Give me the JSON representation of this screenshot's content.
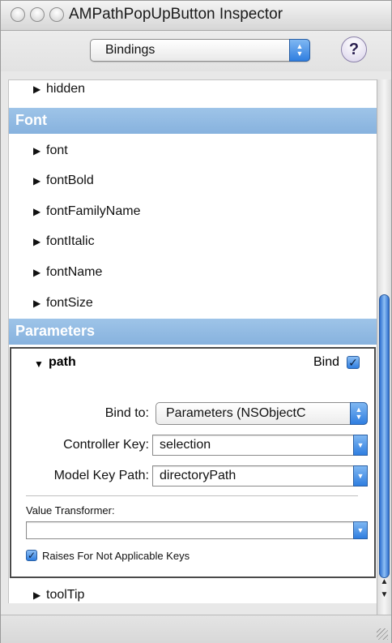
{
  "window": {
    "title": "AMPathPopUpButton Inspector"
  },
  "toolbar": {
    "mode_popup": "Bindings",
    "help_label": "?"
  },
  "rows_top": [
    {
      "label": "hidden"
    }
  ],
  "sections": {
    "font": {
      "title": "Font",
      "items": [
        "font",
        "fontBold",
        "fontFamilyName",
        "fontItalic",
        "fontName",
        "fontSize"
      ]
    },
    "parameters": {
      "title": "Parameters"
    }
  },
  "path_panel": {
    "name": "path",
    "bind_label": "Bind",
    "bind_checked": true,
    "bind_to_label": "Bind to:",
    "bind_to_value": "Parameters (NSObjectC",
    "controller_key_label": "Controller Key:",
    "controller_key_value": "selection",
    "model_key_path_label": "Model Key Path:",
    "model_key_path_value": "directoryPath",
    "value_transformer_label": "Value Transformer:",
    "value_transformer_value": "",
    "raises_label": "Raises For Not Applicable Keys",
    "raises_checked": true
  },
  "rows_bottom": [
    {
      "label": "toolTip"
    }
  ],
  "colors": {
    "section_header": "#87b2de",
    "accent": "#2f7ee0"
  }
}
